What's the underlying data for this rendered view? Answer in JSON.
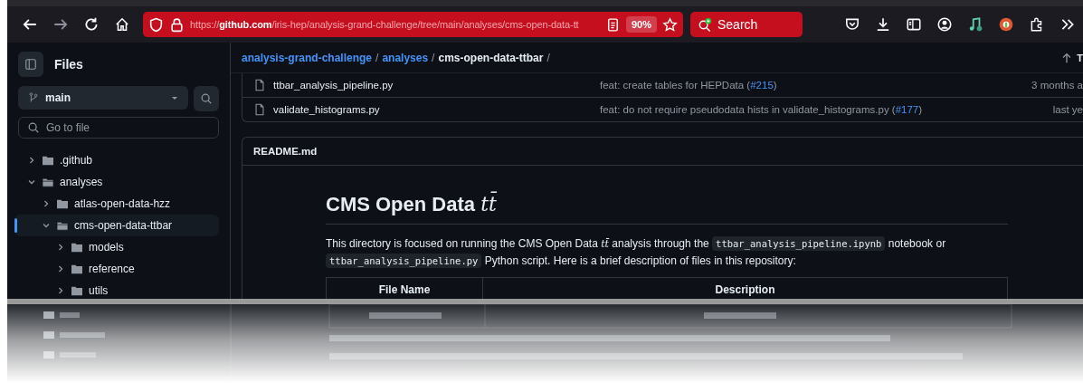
{
  "browser": {
    "url_scheme": "https://",
    "url_host": "github.com",
    "url_path": "/iris-hep/analysis-grand-challenge/tree/main/analyses/cms-open-data-tt",
    "zoom": "90%",
    "search": "Search"
  },
  "sidebar": {
    "title": "Files",
    "branch": "main",
    "placeholder": "Go to file",
    "tree": [
      {
        "name": ".github",
        "expanded": false,
        "selected": false
      },
      {
        "name": "analyses",
        "expanded": true,
        "selected": false,
        "children": [
          {
            "name": "atlas-open-data-hzz",
            "expanded": false,
            "selected": false
          },
          {
            "name": "cms-open-data-ttbar",
            "expanded": true,
            "selected": true,
            "children": [
              {
                "name": "models",
                "expanded": false,
                "selected": false
              },
              {
                "name": "reference",
                "expanded": false,
                "selected": false
              },
              {
                "name": "utils",
                "expanded": false,
                "selected": false
              }
            ]
          }
        ]
      }
    ]
  },
  "breadcrumb": {
    "parts": [
      {
        "text": "analysis-grand-challenge",
        "kind": "link"
      },
      {
        "text": "/",
        "kind": "sep"
      },
      {
        "text": "analyses",
        "kind": "link"
      },
      {
        "text": "/",
        "kind": "sep"
      },
      {
        "text": "cms-open-data-ttbar",
        "kind": "current"
      },
      {
        "text": "/",
        "kind": "sep"
      }
    ],
    "top_button": "T"
  },
  "files": [
    {
      "name": "ttbar_analysis_pipeline.py",
      "message": "feat: create tables for HEPData (",
      "pr": "#215",
      "message_end": ")",
      "date": "3 months a"
    },
    {
      "name": "validate_histograms.py",
      "message": "feat: do not require pseudodata hists in validate_histograms.py (",
      "pr": "#177",
      "message_end": ")",
      "date": "last ye"
    }
  ],
  "readme": {
    "filename": "README.md",
    "title": "CMS Open Data",
    "title_math": "tt̄",
    "paragraph": [
      {
        "kind": "text",
        "text": "This directory is focused on running the CMS Open Data "
      },
      {
        "kind": "math",
        "text": "tt̄"
      },
      {
        "kind": "text",
        "text": " analysis through the "
      },
      {
        "kind": "code",
        "text": "ttbar_analysis_pipeline.ipynb"
      },
      {
        "kind": "text",
        "text": " notebook or "
      },
      {
        "kind": "code",
        "text": "ttbar_analysis_pipeline.py"
      },
      {
        "kind": "text",
        "text": " Python script. Here is a brief description of files in this repository:"
      }
    ],
    "table_columns": [
      "File Name",
      "Description"
    ]
  }
}
